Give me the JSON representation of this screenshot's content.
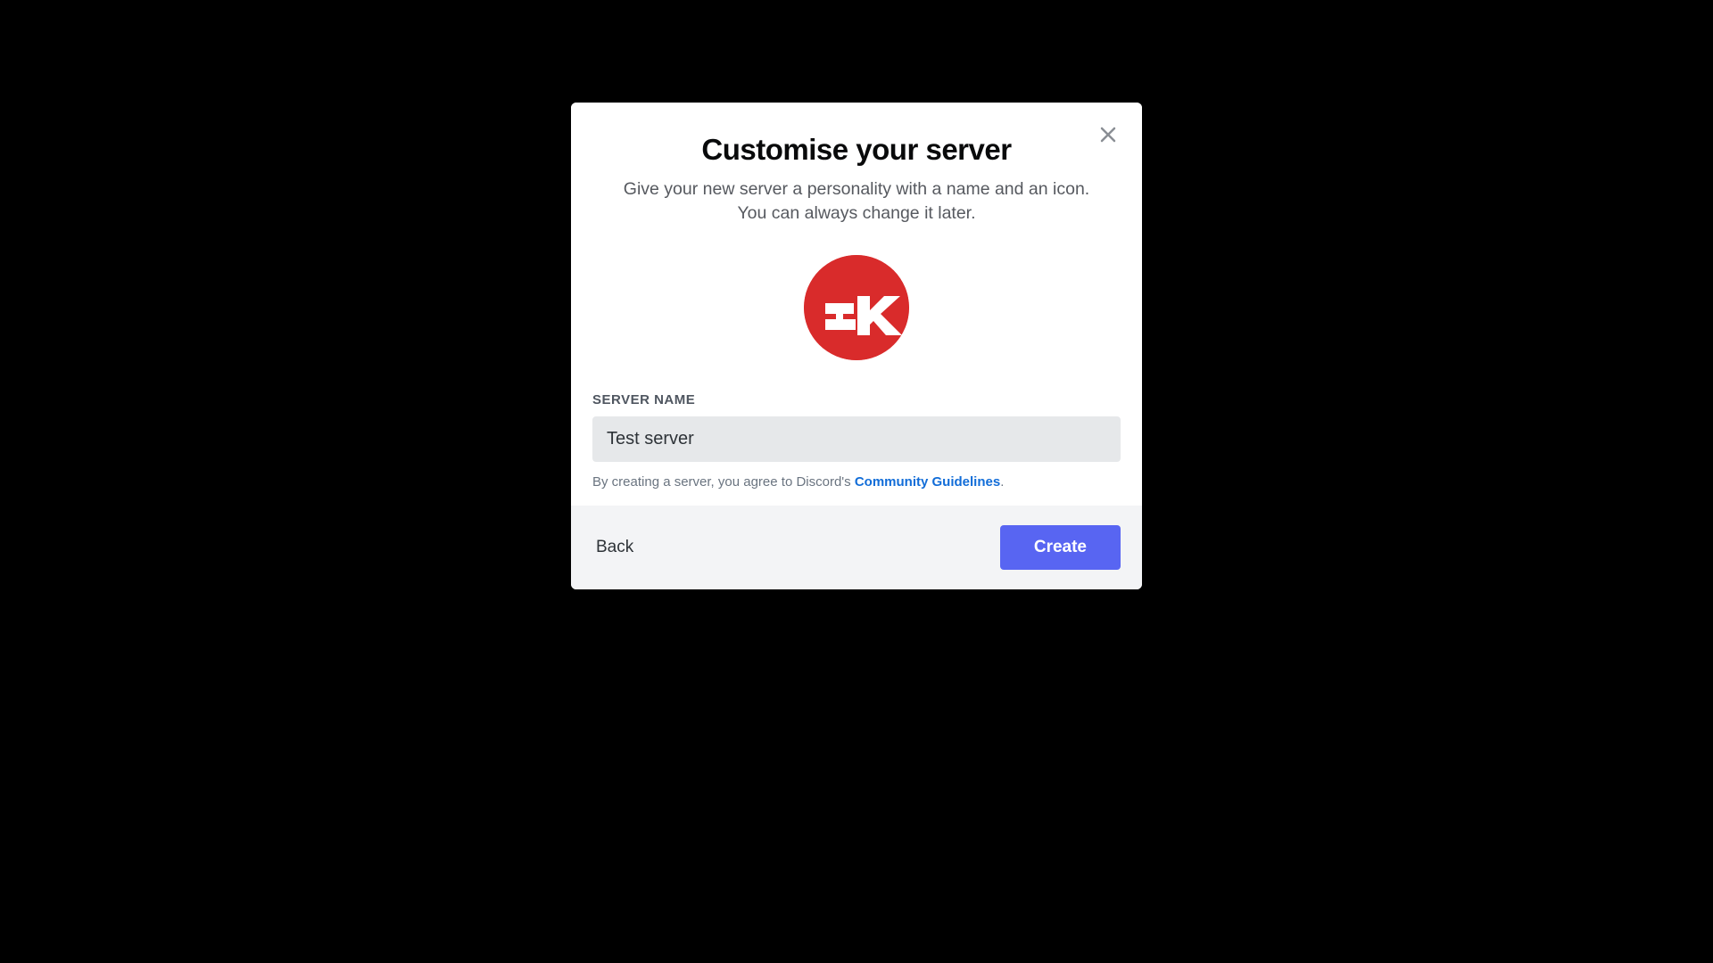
{
  "modal": {
    "title": "Customise your server",
    "subtitle": "Give your new server a personality with a name and an icon. You can always change it later.",
    "server_name_label": "SERVER NAME",
    "server_name_value": "Test server",
    "agreement_prefix": "By creating a server, you agree to Discord's ",
    "agreement_link": "Community Guidelines",
    "agreement_suffix": ".",
    "back_label": "Back",
    "create_label": "Create",
    "icon_text": "sk"
  }
}
